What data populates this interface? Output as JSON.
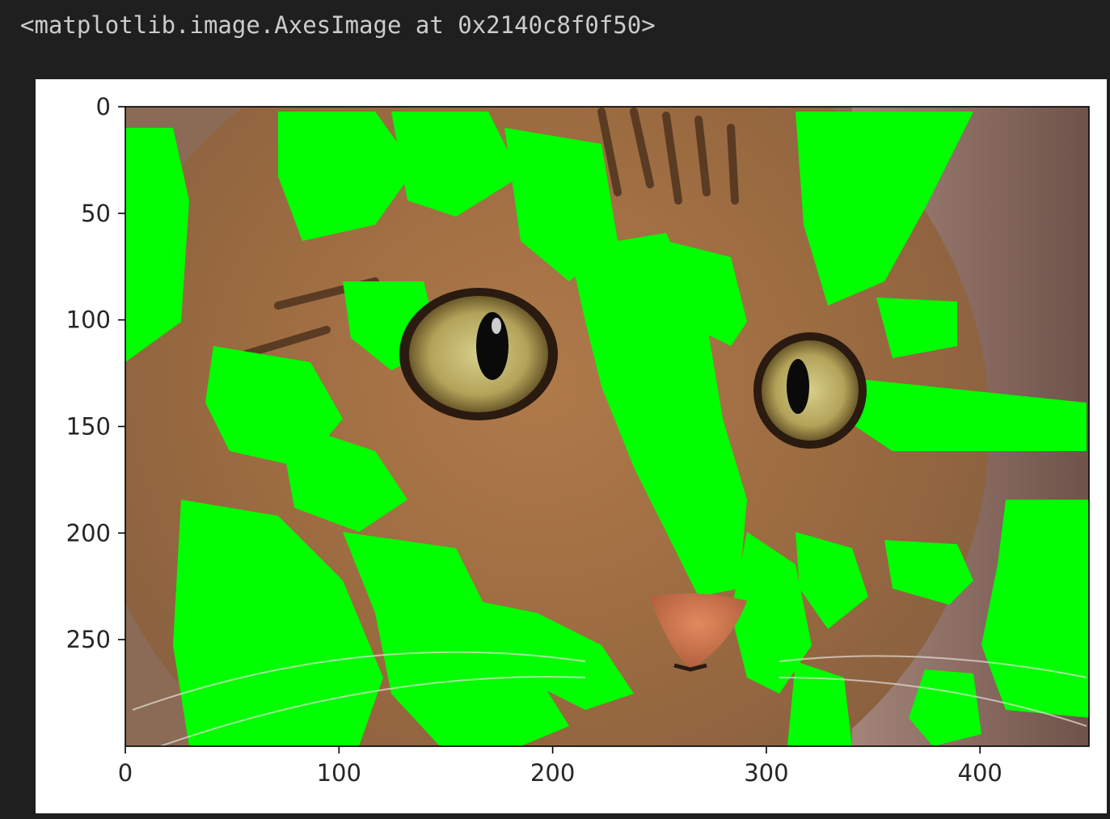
{
  "output": {
    "repr_text": "<matplotlib.image.AxesImage at 0x2140c8f0f50>"
  },
  "figure": {
    "image_subject": "close-up photo of a tabby cat face with bright green (#00ff00) masked regions",
    "mask_color": "#00ff00",
    "background_color": "#1f1f1f",
    "figure_background": "#ffffff"
  },
  "chart_data": {
    "type": "heatmap",
    "title": "",
    "xlabel": "",
    "ylabel": "",
    "xlim": [
      0,
      451
    ],
    "ylim": [
      300,
      0
    ],
    "xticks": [
      0,
      100,
      200,
      300,
      400
    ],
    "yticks": [
      0,
      50,
      100,
      150,
      200,
      250
    ],
    "xtick_labels": [
      "0",
      "100",
      "200",
      "300",
      "400"
    ],
    "ytick_labels": [
      "0",
      "50",
      "100",
      "150",
      "200",
      "250"
    ],
    "grid": false
  }
}
